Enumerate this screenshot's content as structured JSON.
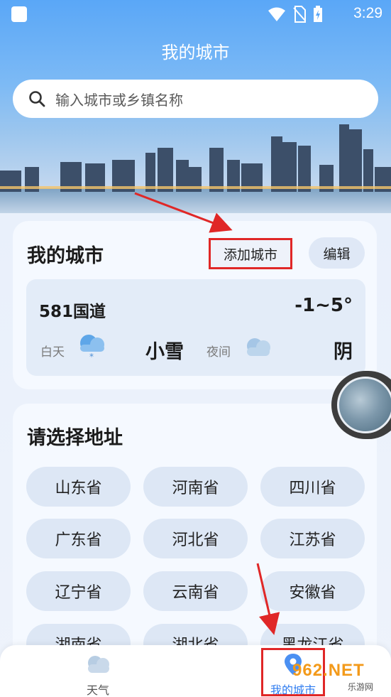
{
  "status_bar": {
    "time": "3:29"
  },
  "header": {
    "title": "我的城市",
    "search_placeholder": "输入城市或乡镇名称"
  },
  "my_cities": {
    "title": "我的城市",
    "add_label": "添加城市",
    "edit_label": "编辑",
    "city": {
      "name": "581国道",
      "temp_range": "-1~5°",
      "day_label": "白天",
      "day_weather": "小雪",
      "night_label": "夜间",
      "night_weather": "阴"
    }
  },
  "province_section": {
    "title": "请选择地址",
    "provinces": [
      "山东省",
      "河南省",
      "四川省",
      "广东省",
      "河北省",
      "江苏省",
      "辽宁省",
      "云南省",
      "安徽省",
      "湖南省",
      "湖北省",
      "黑龙江省"
    ]
  },
  "tabbar": {
    "tabs": [
      {
        "label": "天气",
        "icon": "cloud-icon"
      },
      {
        "label": "我的城市",
        "icon": "location-pin-icon"
      }
    ]
  },
  "watermark": {
    "brand": "962.NET",
    "sub": "乐游网"
  },
  "colors": {
    "accent": "#2f7cf0",
    "highlight_box": "#e02727",
    "sky": "#5aa7f7"
  }
}
